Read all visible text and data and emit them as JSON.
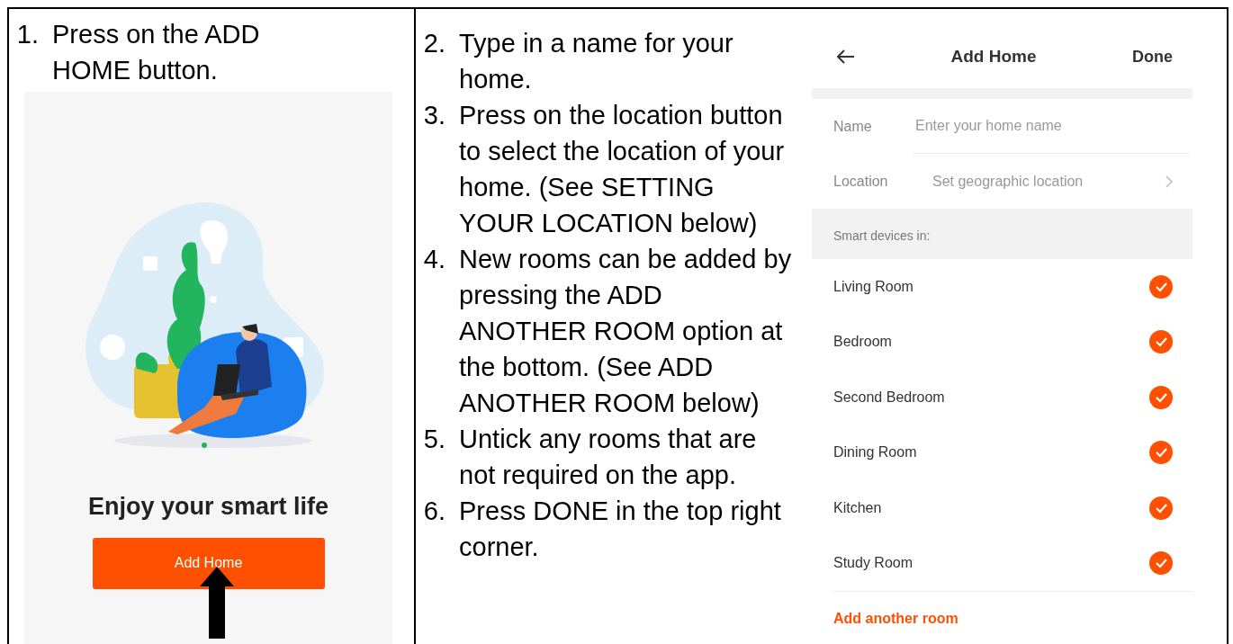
{
  "steps_left": [
    {
      "number": "1.",
      "text": "Press on the ADD HOME button."
    }
  ],
  "welcome_screen": {
    "headline": "Enjoy your smart life",
    "button": "Add Home"
  },
  "steps_right": [
    {
      "number": "2.",
      "text": "Type in a name for your home."
    },
    {
      "number": "3.",
      "text": "Press on the location button to select the location of your home. (See SETTING YOUR LOCATION below)"
    },
    {
      "number": "4.",
      "text": "New rooms can be added by pressing the ADD ANOTHER ROOM option at the bottom. (See ADD ANOTHER ROOM below)"
    },
    {
      "number": "5.",
      "text": "Untick any rooms that are not required on the app."
    },
    {
      "number": "6.",
      "text": "Press DONE in the top right corner."
    }
  ],
  "add_home_screen": {
    "title": "Add Home",
    "done": "Done",
    "name_label": "Name",
    "name_placeholder": "Enter your home name",
    "location_label": "Location",
    "location_value": "Set geographic location",
    "section_title": "Smart devices in:",
    "rooms": [
      {
        "name": "Living Room",
        "checked": true
      },
      {
        "name": "Bedroom",
        "checked": true
      },
      {
        "name": "Second Bedroom",
        "checked": true
      },
      {
        "name": "Dining Room",
        "checked": true
      },
      {
        "name": "Kitchen",
        "checked": true
      },
      {
        "name": "Study Room",
        "checked": true
      }
    ],
    "add_room": "Add another room"
  }
}
